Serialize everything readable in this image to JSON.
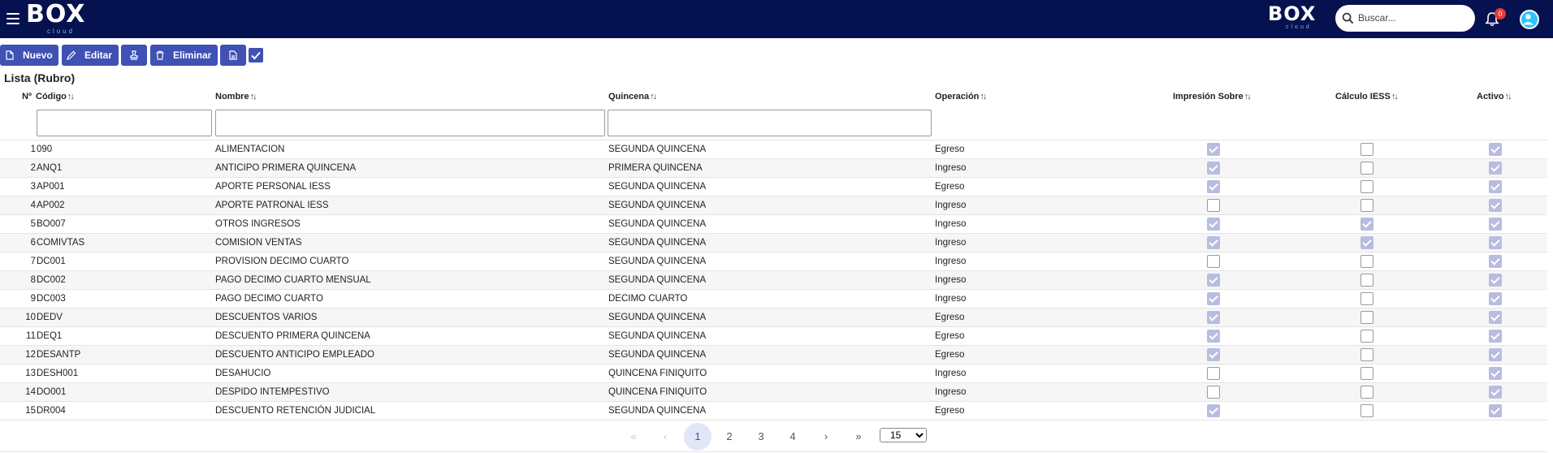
{
  "header": {
    "logo_left": "BOX",
    "logo_left_sub": "cloud",
    "logo_right": "BOX",
    "logo_right_sub": "cloud",
    "search_placeholder": "Buscar...",
    "notifications_count": "0",
    "colors": {
      "bar": "#06114f",
      "badge": "#e53935"
    },
    "icons": [
      "menu-icon",
      "search-icon",
      "bell-icon",
      "user-avatar-icon"
    ]
  },
  "toolbar": {
    "new_label": "Nuevo",
    "edit_label": "Editar",
    "delete_label": "Eliminar",
    "icons": [
      "file-icon",
      "pencil-icon",
      "stamp-icon",
      "trash-icon",
      "document-icon",
      "check-icon"
    ]
  },
  "list_title": "Lista (Rubro)",
  "columns": {
    "num": "Nº",
    "code": "Código",
    "name": "Nombre",
    "quincena": "Quincena",
    "operation": "Operación",
    "print": "Impresión Sobre",
    "iess": "Cálculo IESS",
    "active": "Activo"
  },
  "rows": [
    {
      "n": "1",
      "code": "090",
      "name": "ALIMENTACION",
      "quincena": "SEGUNDA QUINCENA",
      "op": "Egreso",
      "print": true,
      "iess": false,
      "active": true
    },
    {
      "n": "2",
      "code": "ANQ1",
      "name": "ANTICIPO PRIMERA QUINCENA",
      "quincena": "PRIMERA QUINCENA",
      "op": "Ingreso",
      "print": true,
      "iess": false,
      "active": true
    },
    {
      "n": "3",
      "code": "AP001",
      "name": "APORTE PERSONAL IESS",
      "quincena": "SEGUNDA QUINCENA",
      "op": "Egreso",
      "print": true,
      "iess": false,
      "active": true
    },
    {
      "n": "4",
      "code": "AP002",
      "name": "APORTE PATRONAL IESS",
      "quincena": "SEGUNDA QUINCENA",
      "op": "Ingreso",
      "print": false,
      "iess": false,
      "active": true
    },
    {
      "n": "5",
      "code": "BO007",
      "name": "OTROS INGRESOS",
      "quincena": "SEGUNDA QUINCENA",
      "op": "Ingreso",
      "print": true,
      "iess": true,
      "active": true
    },
    {
      "n": "6",
      "code": "COMIVTAS",
      "name": "COMISION VENTAS",
      "quincena": "SEGUNDA QUINCENA",
      "op": "Ingreso",
      "print": true,
      "iess": true,
      "active": true
    },
    {
      "n": "7",
      "code": "DC001",
      "name": "PROVISION DECIMO CUARTO",
      "quincena": "SEGUNDA QUINCENA",
      "op": "Ingreso",
      "print": false,
      "iess": false,
      "active": true
    },
    {
      "n": "8",
      "code": "DC002",
      "name": "PAGO DECIMO CUARTO MENSUAL",
      "quincena": "SEGUNDA QUINCENA",
      "op": "Ingreso",
      "print": true,
      "iess": false,
      "active": true
    },
    {
      "n": "9",
      "code": "DC003",
      "name": "PAGO DECIMO CUARTO",
      "quincena": "DECIMO CUARTO",
      "op": "Ingreso",
      "print": true,
      "iess": false,
      "active": true
    },
    {
      "n": "10",
      "code": "DEDV",
      "name": "DESCUENTOS VARIOS",
      "quincena": "SEGUNDA QUINCENA",
      "op": "Egreso",
      "print": true,
      "iess": false,
      "active": true
    },
    {
      "n": "11",
      "code": "DEQ1",
      "name": "DESCUENTO PRIMERA QUINCENA",
      "quincena": "SEGUNDA QUINCENA",
      "op": "Egreso",
      "print": true,
      "iess": false,
      "active": true
    },
    {
      "n": "12",
      "code": "DESANTP",
      "name": "DESCUENTO ANTICIPO EMPLEADO",
      "quincena": "SEGUNDA QUINCENA",
      "op": "Egreso",
      "print": true,
      "iess": false,
      "active": true
    },
    {
      "n": "13",
      "code": "DESH001",
      "name": "DESAHUCIO",
      "quincena": "QUINCENA FINIQUITO",
      "op": "Ingreso",
      "print": false,
      "iess": false,
      "active": true
    },
    {
      "n": "14",
      "code": "DO001",
      "name": "DESPIDO INTEMPESTIVO",
      "quincena": "QUINCENA FINIQUITO",
      "op": "Ingreso",
      "print": false,
      "iess": false,
      "active": true
    },
    {
      "n": "15",
      "code": "DR004",
      "name": "DESCUENTO RETENCIÓN JUDICIAL",
      "quincena": "SEGUNDA QUINCENA",
      "op": "Egreso",
      "print": true,
      "iess": false,
      "active": true
    }
  ],
  "pagination": {
    "first": "«",
    "prev": "‹",
    "pages": [
      "1",
      "2",
      "3",
      "4"
    ],
    "current": "1",
    "next": "›",
    "last": "»",
    "per_page": "15"
  }
}
